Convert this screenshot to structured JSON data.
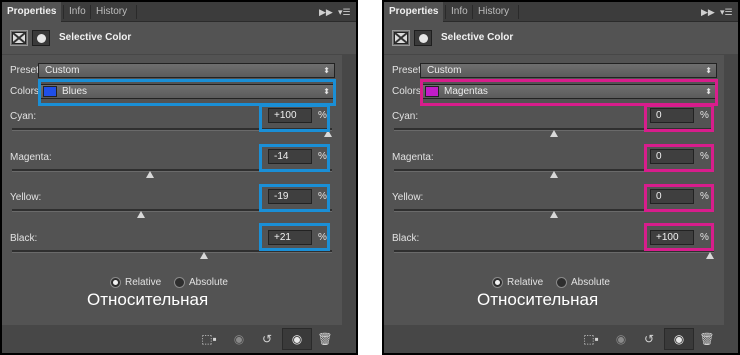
{
  "tabs": [
    "Properties",
    "Info",
    "History"
  ],
  "toolbar": {
    "collapse_icon": "double-chevron-right",
    "menu_icon": "panel-menu"
  },
  "header": {
    "title": "Selective Color",
    "icons": [
      "adjustment-layer-icon",
      "mask-icon"
    ]
  },
  "labels": {
    "preset": "Preset:",
    "colors": "Colors:",
    "percent": "%"
  },
  "radio_options": [
    "Relative",
    "Absolute"
  ],
  "bottom_icons": [
    "clip-to-layer-icon",
    "view-previous-icon",
    "reset-icon",
    "visibility-eye-icon",
    "trash-icon"
  ],
  "panels": [
    {
      "preset": "Custom",
      "colors": {
        "name": "Blues",
        "swatch": "#1f4fe8"
      },
      "highlight_color": "#1a8fd6",
      "sliders": [
        {
          "label": "Cyan:",
          "value": "+100",
          "percent": 100
        },
        {
          "label": "Magenta:",
          "value": "-14",
          "percent": -14
        },
        {
          "label": "Yellow:",
          "value": "-19",
          "percent": -19
        },
        {
          "label": "Black:",
          "value": "+21",
          "percent": 21
        }
      ],
      "method": "Relative",
      "caption": "Относительная"
    },
    {
      "preset": "Custom",
      "colors": {
        "name": "Magentas",
        "swatch": "#c21cc8"
      },
      "highlight_color": "#d81d8c",
      "sliders": [
        {
          "label": "Cyan:",
          "value": "0",
          "percent": 0
        },
        {
          "label": "Magenta:",
          "value": "0",
          "percent": 0
        },
        {
          "label": "Yellow:",
          "value": "0",
          "percent": 0
        },
        {
          "label": "Black:",
          "value": "+100",
          "percent": 100
        }
      ],
      "method": "Relative",
      "caption": "Относительная"
    }
  ]
}
